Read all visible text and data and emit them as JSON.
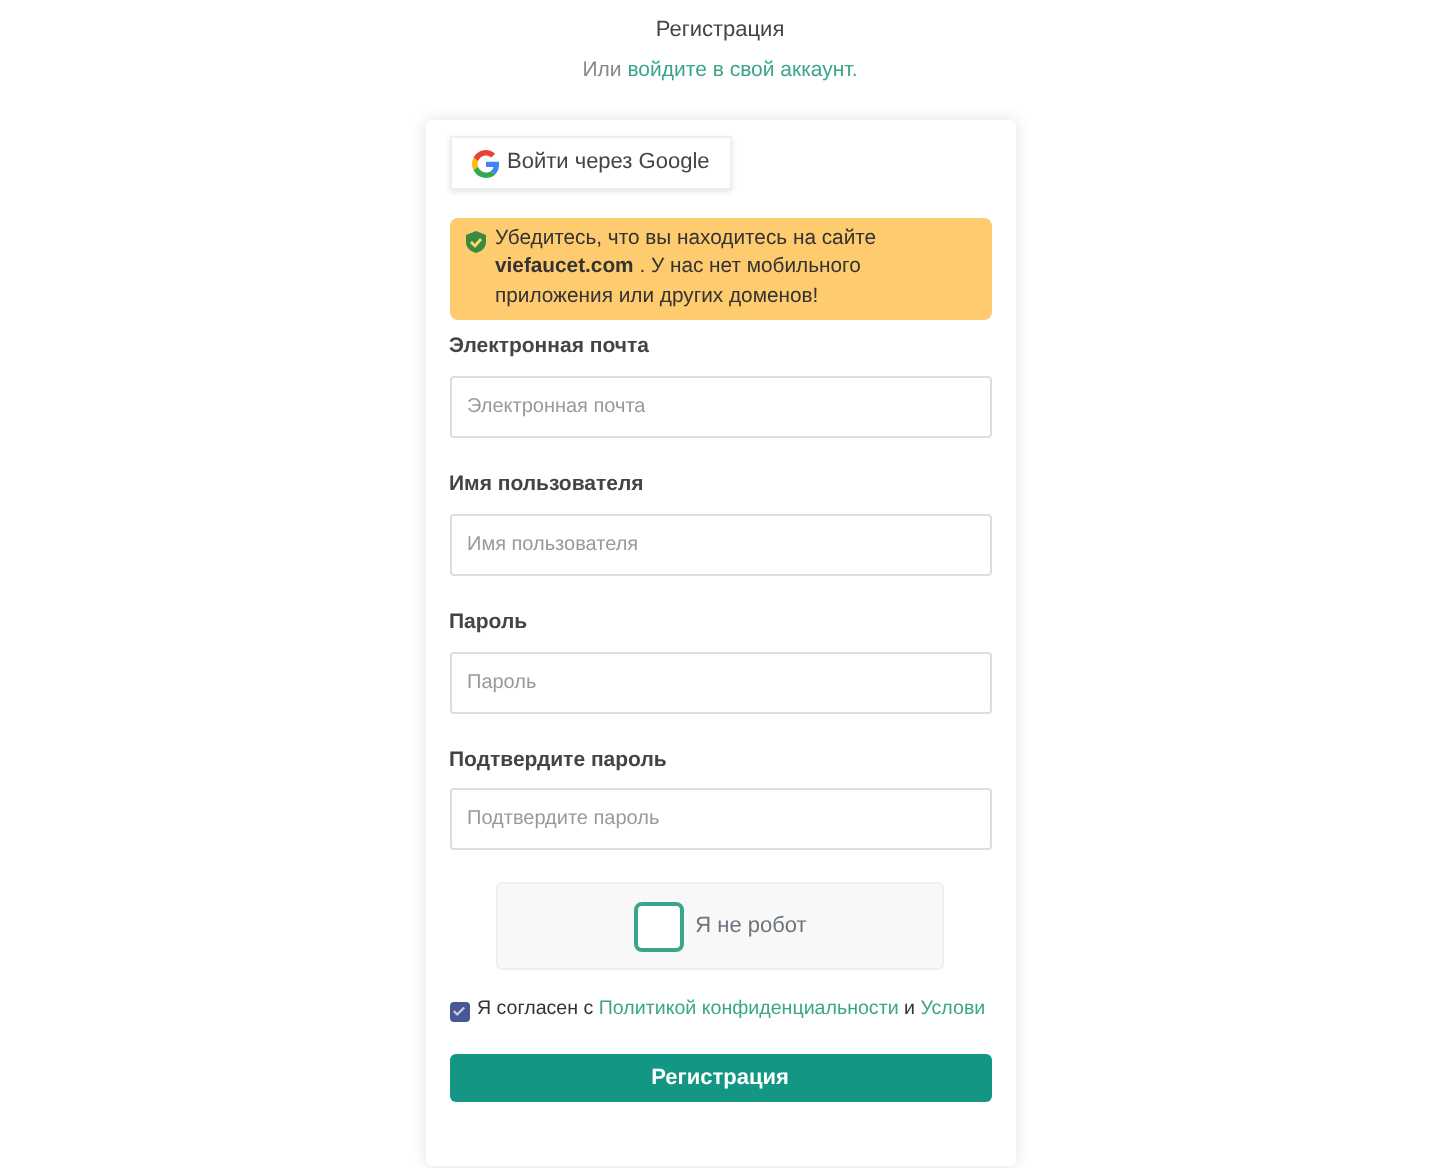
{
  "title": "Регистрация",
  "subtitle": {
    "prefix": "Или",
    "link": "войдите в свой аккаунт."
  },
  "google_button": "Войти через Google",
  "alert": "Убедитесь, что вы находитесь на сайте **viefaucet.com** . У нас нет мобильного приложения или других доменов!",
  "fields": [
    {
      "label": "Электронная почта",
      "placeholder": "Электронная почта"
    },
    {
      "label": "Имя пользователя",
      "placeholder": "Имя пользователя"
    },
    {
      "label": "Пароль",
      "placeholder": "Пароль"
    },
    {
      "label": "Подтвердите пароль",
      "placeholder": "Подтвердите пароль"
    }
  ],
  "captcha": {
    "label": "Я не робот",
    "checked": false
  },
  "consent": {
    "checked": true,
    "prefix": "Я согласен с",
    "link1": "Политикой конфиденциальности",
    "joiner": "и",
    "link2": "Услови"
  },
  "submit": "Регистрация"
}
